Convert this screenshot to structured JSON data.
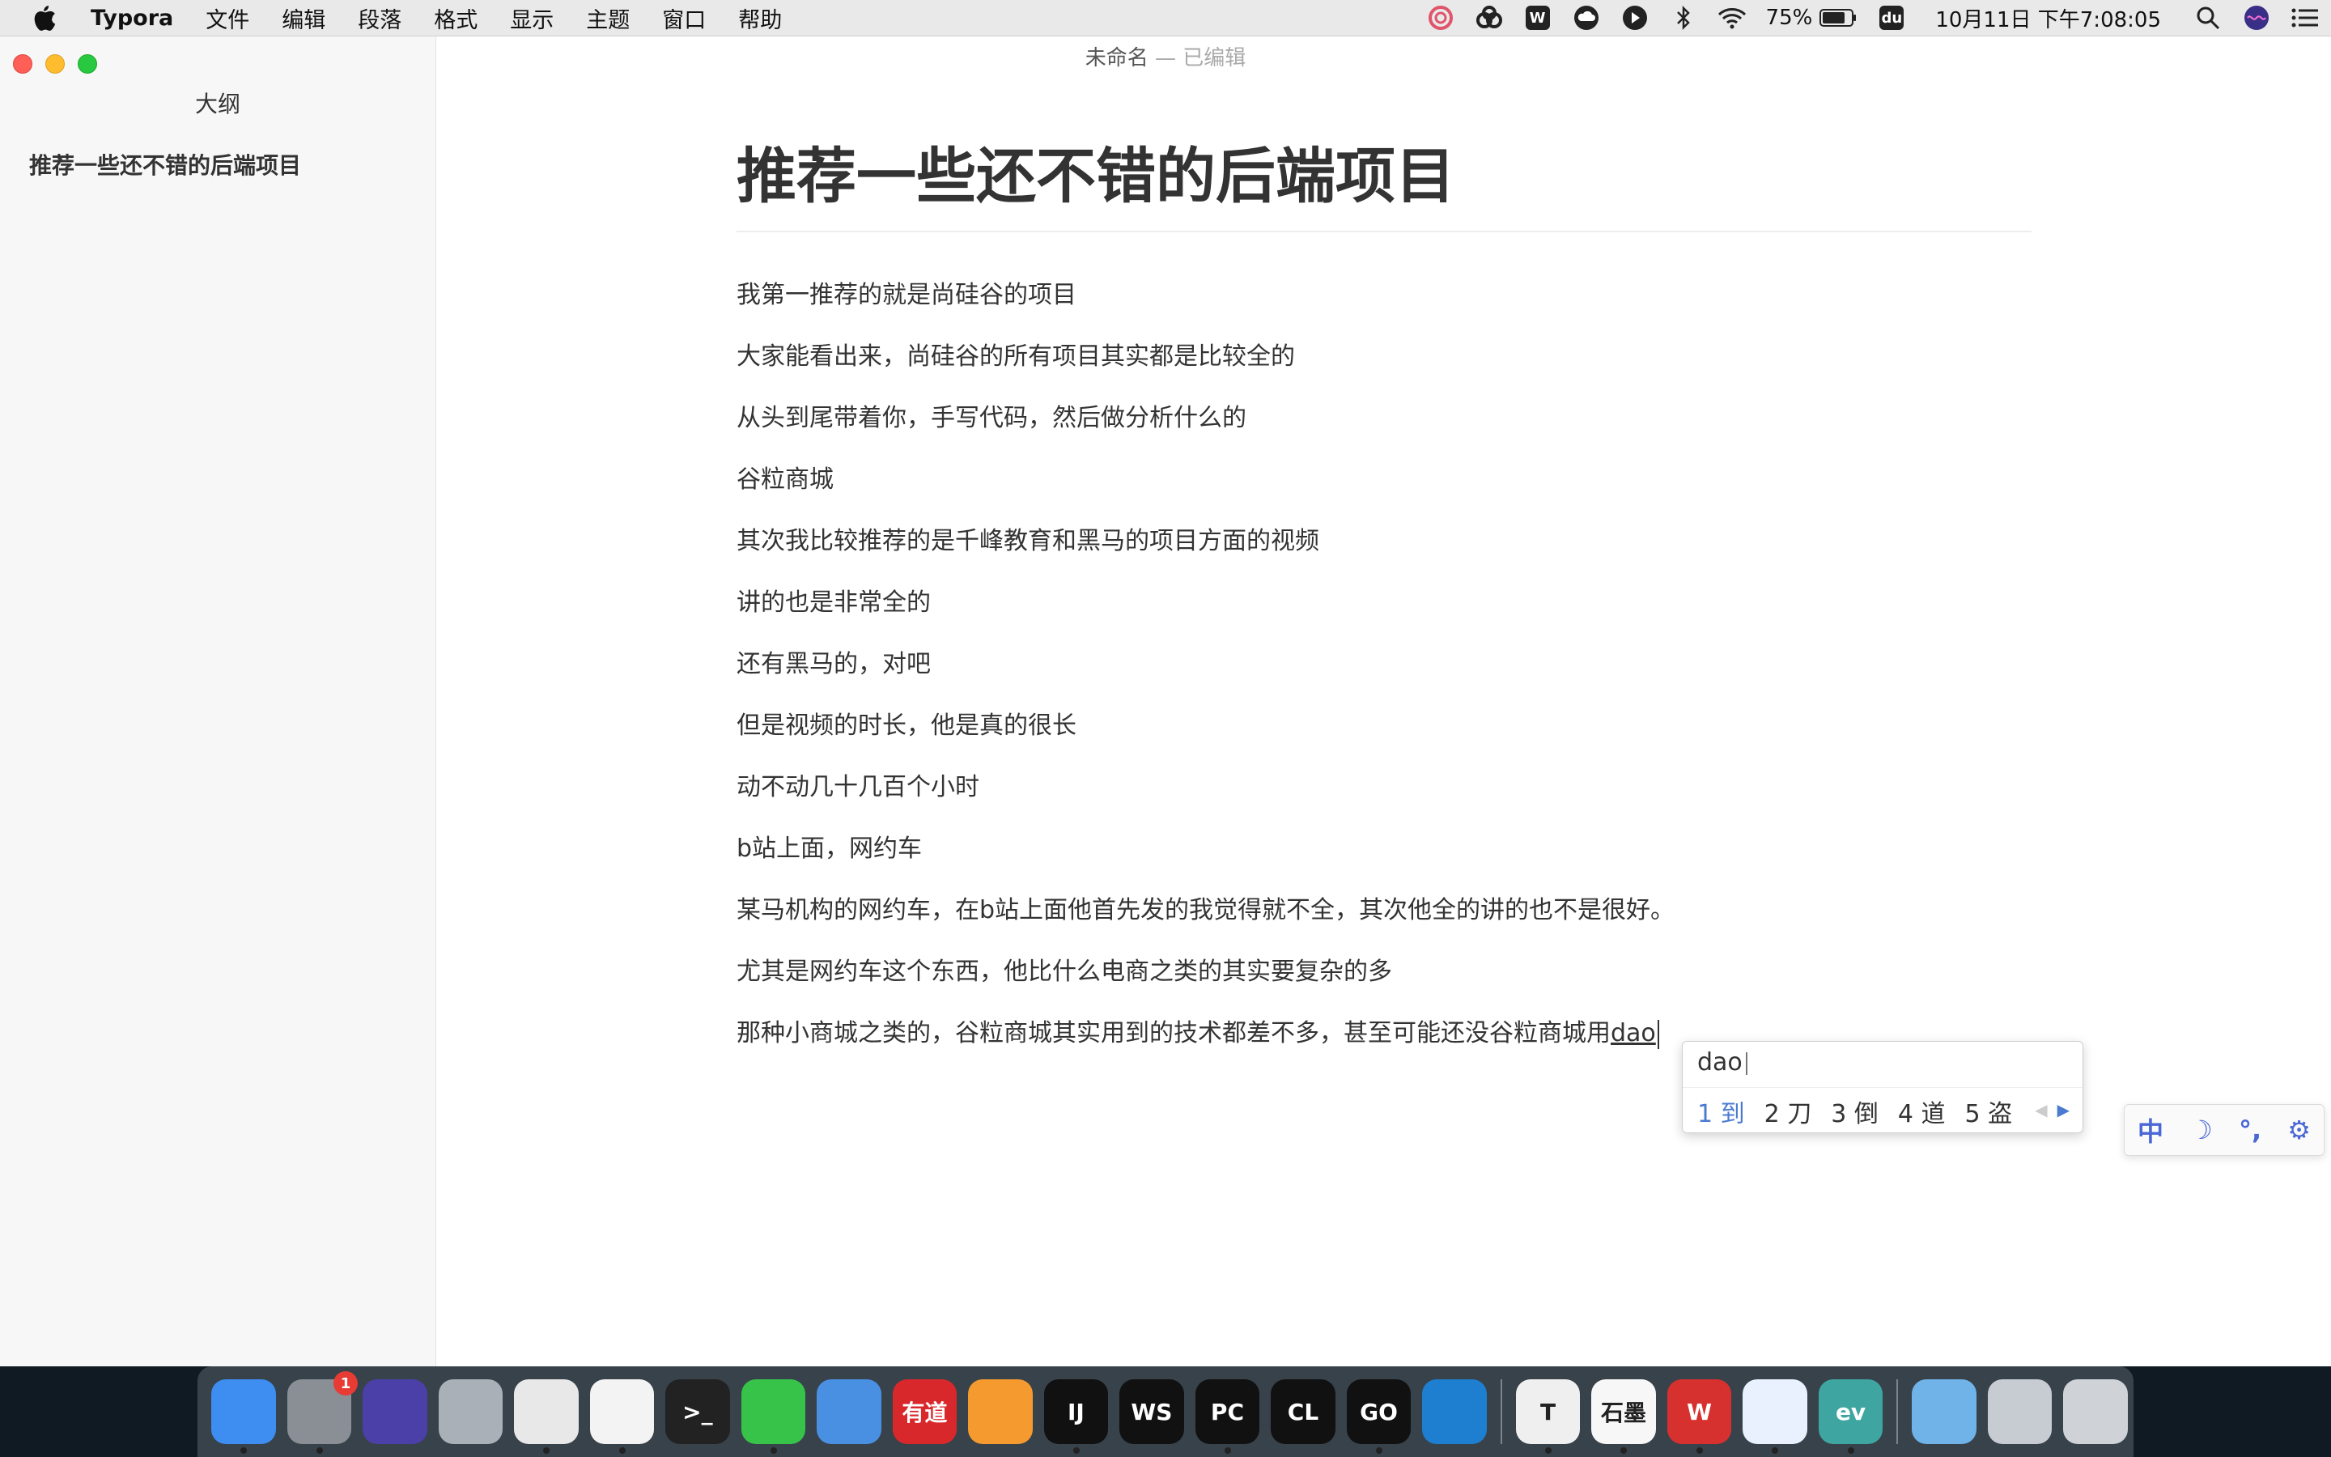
{
  "menubar": {
    "app_name": "Typora",
    "items": [
      "文件",
      "编辑",
      "段落",
      "格式",
      "显示",
      "主题",
      "窗口",
      "帮助"
    ],
    "battery": "75%",
    "du_label": "du",
    "datetime": "10月11日 下午7:08:05"
  },
  "window": {
    "title": "未命名",
    "title_sep": " — ",
    "status": "已编辑"
  },
  "sidebar": {
    "title": "大纲",
    "outline": [
      "推荐一些还不错的后端项目"
    ]
  },
  "document": {
    "heading": "推荐一些还不错的后端项目",
    "paragraphs": [
      "我第一推荐的就是尚硅谷的项目",
      "大家能看出来，尚硅谷的所有项目其实都是比较全的",
      "从头到尾带着你，手写代码，然后做分析什么的",
      "谷粒商城",
      "其次我比较推荐的是千峰教育和黑马的项目方面的视频",
      "讲的也是非常全的",
      "还有黑马的，对吧",
      "但是视频的时长，他是真的很长",
      "动不动几十几百个小时",
      "b站上面，网约车",
      "某马机构的网约车，在b站上面他首先发的我觉得就不全，其次他全的讲的也不是很好。",
      "尤其是网约车这个东西，他比什么电商之类的其实要复杂的多"
    ],
    "last_line": "那种小商城之类的，谷粒商城其实用到的技术都差不多，甚至可能还没谷粒商城用",
    "typed": "dao"
  },
  "ime": {
    "pinyin": "dao",
    "candidates": [
      "1 到",
      "2 刀",
      "3 倒",
      "4 道",
      "5 盗"
    ],
    "prev": "◀",
    "next": "▶"
  },
  "imebar": {
    "lang": "中",
    "moon": "☽",
    "punct": "°,",
    "settings": "⚙"
  },
  "dock": {
    "badge": "1",
    "apps": [
      {
        "name": "finder",
        "label": "",
        "color": "#3d8ef0"
      },
      {
        "name": "system-preferences",
        "label": "",
        "color": "#8a8f96"
      },
      {
        "name": "siri",
        "label": "",
        "color": "#4b3fa8"
      },
      {
        "name": "launchpad",
        "label": "",
        "color": "#a9b0b8"
      },
      {
        "name": "chrome",
        "label": "",
        "color": "#e8e8e8"
      },
      {
        "name": "qq",
        "label": "",
        "color": "#f3f3f3"
      },
      {
        "name": "terminal",
        "label": ">_",
        "color": "#222222"
      },
      {
        "name": "wechat",
        "label": "",
        "color": "#37c34a"
      },
      {
        "name": "notes-pen",
        "label": "",
        "color": "#4a90e2"
      },
      {
        "name": "youdao",
        "label": "有道",
        "color": "#d8282b"
      },
      {
        "name": "rainbow-app",
        "label": "",
        "color": "#f49a2e"
      },
      {
        "name": "intellij",
        "label": "IJ",
        "color": "#111111"
      },
      {
        "name": "webstorm",
        "label": "WS",
        "color": "#111111"
      },
      {
        "name": "pycharm",
        "label": "PC",
        "color": "#111111"
      },
      {
        "name": "clion",
        "label": "CL",
        "color": "#111111"
      },
      {
        "name": "goland",
        "label": "GO",
        "color": "#111111"
      },
      {
        "name": "vscode",
        "label": "",
        "color": "#1e7fd0"
      },
      {
        "name": "typora",
        "label": "T",
        "color": "#efefef"
      },
      {
        "name": "shimo",
        "label": "石墨",
        "color": "#f7f7f7"
      },
      {
        "name": "wps",
        "label": "W",
        "color": "#d7312f"
      },
      {
        "name": "baidu-netdisk",
        "label": "",
        "color": "#e8f1fd"
      },
      {
        "name": "ev-app",
        "label": "ev",
        "color": "#3ea5a0"
      },
      {
        "name": "downloads-folder",
        "label": "",
        "color": "#6fb3e8"
      },
      {
        "name": "screenshot-app",
        "label": "",
        "color": "#c7ccd2"
      },
      {
        "name": "trash",
        "label": "",
        "color": "#cfd3d8"
      }
    ]
  }
}
